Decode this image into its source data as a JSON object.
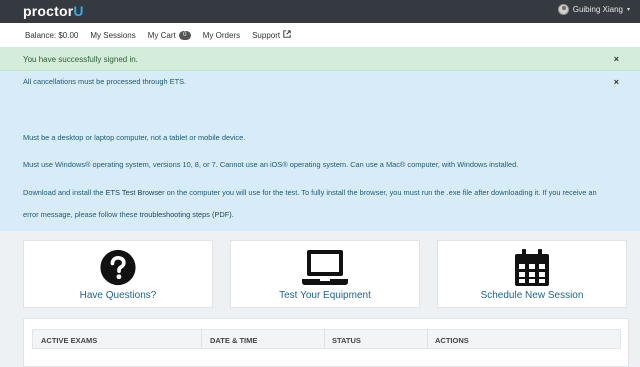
{
  "brand": {
    "logo_main": "proctor",
    "logo_accent": "U"
  },
  "user": {
    "name": "Guibing Xiang",
    "caret": "▾"
  },
  "nav": {
    "balance": "Balance: $0.00",
    "sessions": "My Sessions",
    "cart": "My Cart",
    "cart_count": "0",
    "orders": "My Orders",
    "support": "Support"
  },
  "alerts": {
    "success": "You have successfully signed in.",
    "info_title": "All cancellations must be processed through ETS.",
    "close": "×",
    "lines": {
      "l1": "Must be a desktop or laptop computer, not a tablet or mobile device.",
      "l2": "Must use Windows® operating system, versions 10, 8, or 7. Cannot use an iOS® operating system. Can use a Mac® computer, with Windows installed.",
      "l3_a": "Download and install the ",
      "l3_link": "ETS Test Browser",
      "l3_b": " on the computer you will use for the test. To fully install the browser, you must run the .exe file after downloading it. If you receive an",
      "l4_a": "error message, please follow these ",
      "l4_link": "troubleshooting steps (PDF)",
      "l4_b": "."
    }
  },
  "cards": [
    {
      "label": "Have Questions?",
      "icon": "question-circle-icon"
    },
    {
      "label": "Test Your Equipment",
      "icon": "laptop-icon"
    },
    {
      "label": "Schedule New Session",
      "icon": "calendar-icon"
    }
  ],
  "table": {
    "headers": [
      "ACTIVE EXAMS",
      "DATE & TIME",
      "STATUS",
      "ACTIONS"
    ]
  },
  "colors": {
    "topbar": "#343a40",
    "success_bg": "#d4edda",
    "info_bg": "#d7ecf8",
    "link": "#1e6496"
  }
}
